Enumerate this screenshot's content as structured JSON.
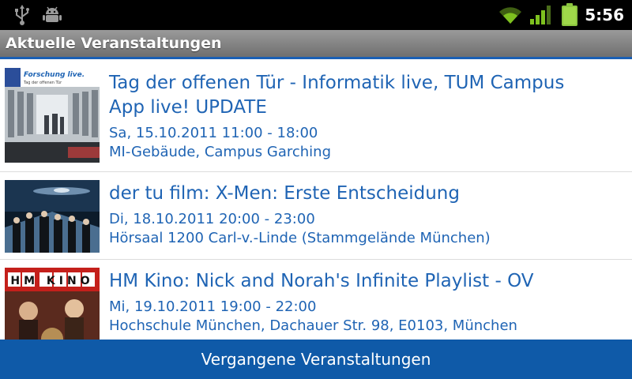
{
  "status_bar": {
    "time": "5:56",
    "icons": [
      "usb-icon",
      "android-debug-icon",
      "wifi-icon",
      "signal-icon",
      "battery-icon"
    ],
    "colors": {
      "icon_gray": "#9a9a9a",
      "green": "#7ec11f"
    }
  },
  "header": {
    "title": "Aktuelle Veranstaltungen",
    "accent": "#1a5fb4"
  },
  "events": [
    {
      "title": "Tag der offenen Tür - Informatik live, TUM Campus App live! UPDATE",
      "date": "Sa, 15.10.2011 11:00 - 18:00",
      "location": "MI-Gebäude, Campus Garching",
      "thumb": {
        "caption": "Forschung live.",
        "subcaption": "Tag der offenen Tür"
      }
    },
    {
      "title": "der tu film: X-Men: Erste Entscheidung",
      "date": "Di, 18.10.2011 20:00 - 23:00",
      "location": "Hörsaal 1200 Carl-v.-Linde (Stammgelände München)"
    },
    {
      "title": "HM Kino: Nick and Norah's Infinite Playlist - OV",
      "date": "Mi, 19.10.2011 19:00 - 22:00",
      "location": "Hochschule München, Dachauer Str. 98, E0103, München",
      "thumb": {
        "caption": "HM KINO"
      }
    }
  ],
  "footer": {
    "button_label": "Vergangene Veranstaltungen",
    "color": "#0f5aa8"
  },
  "text_color": "#1f64b4"
}
